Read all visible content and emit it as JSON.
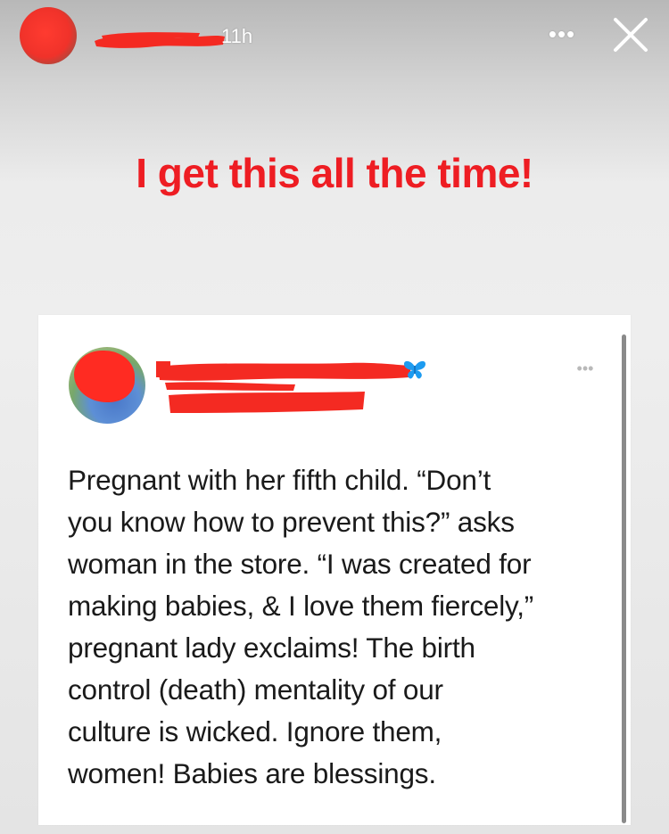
{
  "story": {
    "time": "11h",
    "more": "•••",
    "caption": "I get this all the time!"
  },
  "tweet": {
    "more": "•••",
    "icon": "butterfly-icon",
    "lines": [
      "Pregnant with her fifth child. “Don’t",
      "you know how to prevent this?” asks",
      "woman in the store. “I was created for",
      "making babies, & I love them fiercely,”",
      "pregnant lady exclaims! The birth",
      "control (death) mentality of our",
      "culture is wicked. Ignore them,",
      "women! Babies are blessings."
    ]
  },
  "colors": {
    "caption": "#ee1d23",
    "redaction": "#f42a22",
    "butterfly": "#1d9bf0"
  }
}
